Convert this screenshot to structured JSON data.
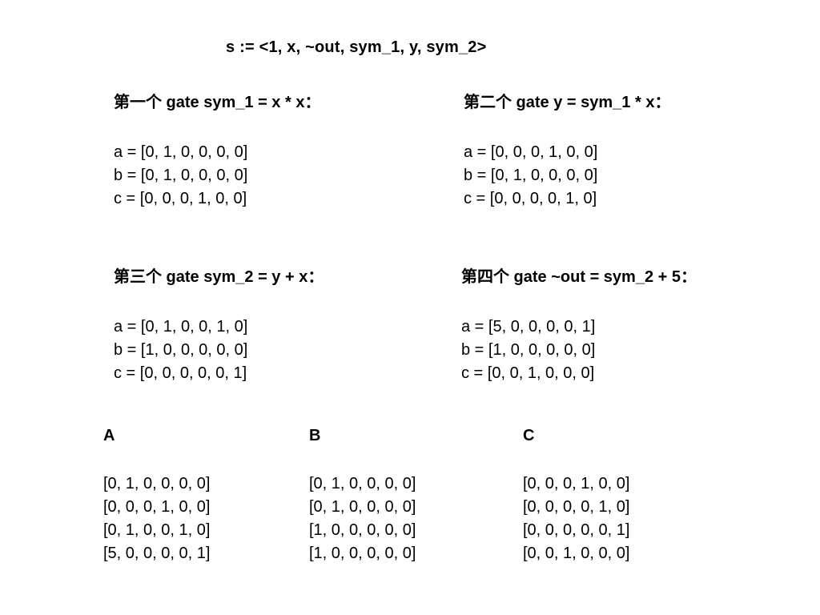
{
  "title": "s := <1, x, ~out, sym_1, y, sym_2>",
  "gates": [
    {
      "heading": "第一个 gate sym_1 = x * x：",
      "a": "a = [0, 1, 0, 0, 0, 0]",
      "b": "b = [0, 1, 0, 0, 0, 0]",
      "c": "c = [0, 0, 0, 1, 0, 0]"
    },
    {
      "heading": "第二个 gate y = sym_1 * x：",
      "a": "a = [0, 0, 0, 1, 0, 0]",
      "b": "b = [0, 1, 0, 0, 0, 0]",
      "c": "c = [0, 0, 0, 0, 1, 0]"
    },
    {
      "heading": "第三个 gate sym_2 = y + x：",
      "a": "a = [0, 1, 0, 0, 1, 0]",
      "b": "b = [1, 0, 0, 0, 0, 0]",
      "c": "c = [0, 0, 0, 0, 0, 1]"
    },
    {
      "heading": "第四个 gate ~out = sym_2 + 5：",
      "a": "a = [5, 0, 0, 0, 0, 1]",
      "b": "b = [1, 0, 0, 0, 0, 0]",
      "c": "c = [0, 0, 1, 0, 0, 0]"
    }
  ],
  "matrices": [
    {
      "name": "A",
      "rows": [
        "[0, 1, 0, 0, 0, 0]",
        "[0, 0, 0, 1, 0, 0]",
        "[0, 1, 0, 0, 1, 0]",
        "[5, 0, 0, 0, 0, 1]"
      ]
    },
    {
      "name": "B",
      "rows": [
        "[0, 1, 0, 0, 0, 0]",
        "[0, 1, 0, 0, 0, 0]",
        "[1, 0, 0, 0, 0, 0]",
        "[1, 0, 0, 0, 0, 0]"
      ]
    },
    {
      "name": "C",
      "rows": [
        "[0, 0, 0, 1, 0, 0]",
        "[0, 0, 0, 0, 1, 0]",
        "[0, 0, 0, 0, 0, 1]",
        "[0, 0, 1, 0, 0, 0]"
      ]
    }
  ]
}
